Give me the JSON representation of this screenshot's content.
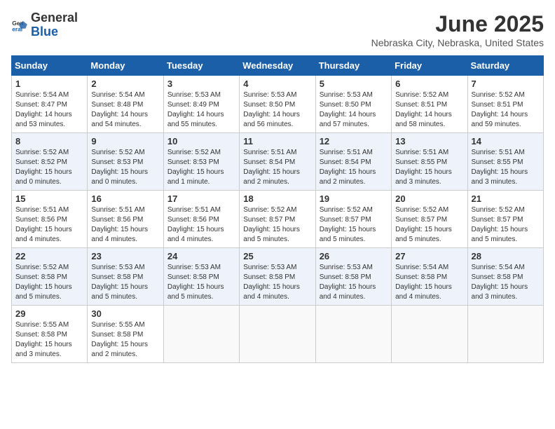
{
  "header": {
    "logo_general": "General",
    "logo_blue": "Blue",
    "month_title": "June 2025",
    "location": "Nebraska City, Nebraska, United States"
  },
  "calendar": {
    "days_of_week": [
      "Sunday",
      "Monday",
      "Tuesday",
      "Wednesday",
      "Thursday",
      "Friday",
      "Saturday"
    ],
    "weeks": [
      [
        {
          "day": "1",
          "sunrise": "5:54 AM",
          "sunset": "8:47 PM",
          "daylight": "14 hours and 53 minutes."
        },
        {
          "day": "2",
          "sunrise": "5:54 AM",
          "sunset": "8:48 PM",
          "daylight": "14 hours and 54 minutes."
        },
        {
          "day": "3",
          "sunrise": "5:53 AM",
          "sunset": "8:49 PM",
          "daylight": "14 hours and 55 minutes."
        },
        {
          "day": "4",
          "sunrise": "5:53 AM",
          "sunset": "8:50 PM",
          "daylight": "14 hours and 56 minutes."
        },
        {
          "day": "5",
          "sunrise": "5:53 AM",
          "sunset": "8:50 PM",
          "daylight": "14 hours and 57 minutes."
        },
        {
          "day": "6",
          "sunrise": "5:52 AM",
          "sunset": "8:51 PM",
          "daylight": "14 hours and 58 minutes."
        },
        {
          "day": "7",
          "sunrise": "5:52 AM",
          "sunset": "8:51 PM",
          "daylight": "14 hours and 59 minutes."
        }
      ],
      [
        {
          "day": "8",
          "sunrise": "5:52 AM",
          "sunset": "8:52 PM",
          "daylight": "15 hours and 0 minutes."
        },
        {
          "day": "9",
          "sunrise": "5:52 AM",
          "sunset": "8:53 PM",
          "daylight": "15 hours and 0 minutes."
        },
        {
          "day": "10",
          "sunrise": "5:52 AM",
          "sunset": "8:53 PM",
          "daylight": "15 hours and 1 minute."
        },
        {
          "day": "11",
          "sunrise": "5:51 AM",
          "sunset": "8:54 PM",
          "daylight": "15 hours and 2 minutes."
        },
        {
          "day": "12",
          "sunrise": "5:51 AM",
          "sunset": "8:54 PM",
          "daylight": "15 hours and 2 minutes."
        },
        {
          "day": "13",
          "sunrise": "5:51 AM",
          "sunset": "8:55 PM",
          "daylight": "15 hours and 3 minutes."
        },
        {
          "day": "14",
          "sunrise": "5:51 AM",
          "sunset": "8:55 PM",
          "daylight": "15 hours and 3 minutes."
        }
      ],
      [
        {
          "day": "15",
          "sunrise": "5:51 AM",
          "sunset": "8:56 PM",
          "daylight": "15 hours and 4 minutes."
        },
        {
          "day": "16",
          "sunrise": "5:51 AM",
          "sunset": "8:56 PM",
          "daylight": "15 hours and 4 minutes."
        },
        {
          "day": "17",
          "sunrise": "5:51 AM",
          "sunset": "8:56 PM",
          "daylight": "15 hours and 4 minutes."
        },
        {
          "day": "18",
          "sunrise": "5:52 AM",
          "sunset": "8:57 PM",
          "daylight": "15 hours and 5 minutes."
        },
        {
          "day": "19",
          "sunrise": "5:52 AM",
          "sunset": "8:57 PM",
          "daylight": "15 hours and 5 minutes."
        },
        {
          "day": "20",
          "sunrise": "5:52 AM",
          "sunset": "8:57 PM",
          "daylight": "15 hours and 5 minutes."
        },
        {
          "day": "21",
          "sunrise": "5:52 AM",
          "sunset": "8:57 PM",
          "daylight": "15 hours and 5 minutes."
        }
      ],
      [
        {
          "day": "22",
          "sunrise": "5:52 AM",
          "sunset": "8:58 PM",
          "daylight": "15 hours and 5 minutes."
        },
        {
          "day": "23",
          "sunrise": "5:53 AM",
          "sunset": "8:58 PM",
          "daylight": "15 hours and 5 minutes."
        },
        {
          "day": "24",
          "sunrise": "5:53 AM",
          "sunset": "8:58 PM",
          "daylight": "15 hours and 5 minutes."
        },
        {
          "day": "25",
          "sunrise": "5:53 AM",
          "sunset": "8:58 PM",
          "daylight": "15 hours and 4 minutes."
        },
        {
          "day": "26",
          "sunrise": "5:53 AM",
          "sunset": "8:58 PM",
          "daylight": "15 hours and 4 minutes."
        },
        {
          "day": "27",
          "sunrise": "5:54 AM",
          "sunset": "8:58 PM",
          "daylight": "15 hours and 4 minutes."
        },
        {
          "day": "28",
          "sunrise": "5:54 AM",
          "sunset": "8:58 PM",
          "daylight": "15 hours and 3 minutes."
        }
      ],
      [
        {
          "day": "29",
          "sunrise": "5:55 AM",
          "sunset": "8:58 PM",
          "daylight": "15 hours and 3 minutes."
        },
        {
          "day": "30",
          "sunrise": "5:55 AM",
          "sunset": "8:58 PM",
          "daylight": "15 hours and 2 minutes."
        },
        null,
        null,
        null,
        null,
        null
      ]
    ]
  }
}
